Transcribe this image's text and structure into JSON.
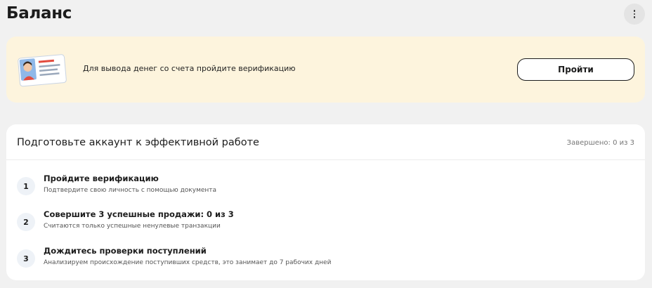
{
  "page": {
    "title": "Баланс",
    "more_icon": "more-vertical-icon"
  },
  "verification_banner": {
    "icon": "id-card-icon",
    "text": "Для вывода денег со счета пройдите верификацию",
    "button_label": "Пройти",
    "background": "#fdf4dd"
  },
  "setup": {
    "title": "Подготовьте аккаунт к эффективной работе",
    "progress": "Завершено: 0 из 3",
    "steps": [
      {
        "number": "1",
        "title": "Пройдите верификацию",
        "description": "Подтвердите свою личность с помощью документа"
      },
      {
        "number": "2",
        "title": "Совершите 3 успешные продажи: 0 из 3",
        "description": "Считаются только успешные ненулевые транзакции"
      },
      {
        "number": "3",
        "title": "Дождитесь проверки поступлений",
        "description": "Анализируем происхождение поступивших средств, это занимает до 7 рабочих дней"
      }
    ]
  }
}
